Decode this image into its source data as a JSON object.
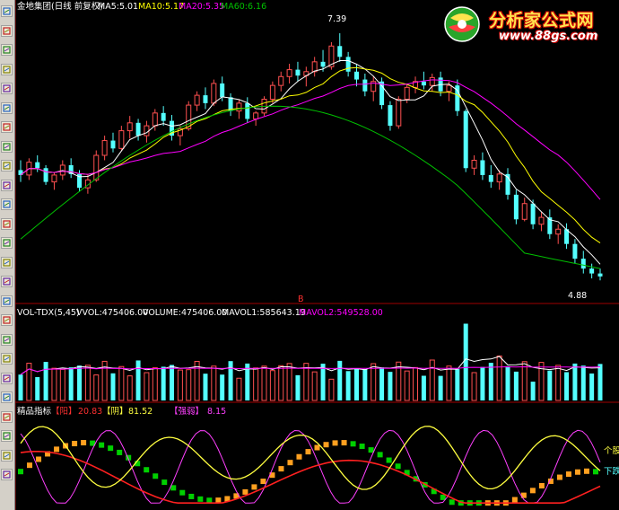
{
  "toolbar": {
    "buttons": [
      {
        "name": "candlestick-icon"
      },
      {
        "name": "line-chart-icon"
      },
      {
        "name": "bar-chart-icon"
      },
      {
        "name": "zoom-icon"
      },
      {
        "name": "grid-icon"
      },
      {
        "name": "indicator-icon"
      },
      {
        "name": "export-icon"
      },
      {
        "name": "settings-icon"
      },
      {
        "name": "window-icon"
      },
      {
        "name": "table-icon"
      },
      {
        "name": "text-icon"
      },
      {
        "name": "calendar-icon"
      },
      {
        "name": "overlay-icon"
      },
      {
        "name": "cursor-icon"
      },
      {
        "name": "split-icon"
      },
      {
        "name": "formula-icon"
      },
      {
        "name": "layout-icon"
      },
      {
        "name": "screen-icon"
      },
      {
        "name": "filter-icon"
      },
      {
        "name": "delete-icon"
      },
      {
        "name": "refresh-icon"
      },
      {
        "name": "arrow-down-icon"
      },
      {
        "name": "arrow-up-icon"
      },
      {
        "name": "arrow-right-icon"
      },
      {
        "name": "arrow-left-icon"
      }
    ]
  },
  "logo": {
    "main": "分析家公式网",
    "url": "www.88gs.com"
  },
  "price_panel": {
    "stock": "金地集团(日线 前复权)",
    "ma5": "MA5:5.01",
    "ma10": "MA10:5.17",
    "ma20": "MA20:5.35",
    "ma60": "MA60:6.16",
    "high_label": "7.39",
    "low_label": "4.88",
    "marker": "B"
  },
  "volume_panel": {
    "title": "VOL-TDX(5,45)",
    "vvol": "VVOL:475406.00",
    "volume": "VOLUME:475406.00",
    "mavol1": "MAVOL1:585643.19",
    "mavol2": "MAVOL2:549528.00"
  },
  "indicator_panel": {
    "title": "精品指标",
    "yang_label": "【阳】",
    "yang_value": "20.83",
    "yin_label": "【阴】",
    "yin_value": "81.52",
    "strong_label": "【强弱】",
    "strong_value": "8.15",
    "right_label_1": "个股",
    "right_label_2": "下跌"
  },
  "colors": {
    "background": "#000000",
    "up": "#ff5050",
    "down": "#54ffff",
    "ma5": "#ffffff",
    "ma10": "#ffff00",
    "ma20": "#ff00ff",
    "ma60": "#00c000",
    "grid": "#a00000",
    "yellow_line": "#ffff40",
    "red_line": "#ff2020",
    "magenta_line": "#ff40ff",
    "green_band": "#00d000",
    "orange_band": "#ffa020"
  },
  "chart_data": {
    "type": "line",
    "price_range": [
      4.7,
      7.6
    ],
    "candles": [
      [
        6.0,
        6.1,
        5.88,
        5.95
      ],
      [
        5.95,
        6.12,
        5.9,
        6.08
      ],
      [
        6.08,
        6.15,
        5.98,
        6.02
      ],
      [
        6.02,
        6.05,
        5.85,
        5.88
      ],
      [
        5.88,
        5.98,
        5.8,
        5.95
      ],
      [
        5.95,
        6.1,
        5.9,
        6.05
      ],
      [
        6.05,
        6.12,
        5.92,
        5.96
      ],
      [
        5.96,
        6.0,
        5.78,
        5.82
      ],
      [
        5.82,
        5.95,
        5.76,
        5.9
      ],
      [
        5.9,
        6.2,
        5.88,
        6.15
      ],
      [
        6.15,
        6.35,
        6.1,
        6.3
      ],
      [
        6.3,
        6.38,
        6.18,
        6.22
      ],
      [
        6.22,
        6.45,
        6.2,
        6.4
      ],
      [
        6.4,
        6.55,
        6.32,
        6.48
      ],
      [
        6.48,
        6.52,
        6.3,
        6.35
      ],
      [
        6.35,
        6.5,
        6.28,
        6.45
      ],
      [
        6.45,
        6.62,
        6.4,
        6.58
      ],
      [
        6.58,
        6.65,
        6.45,
        6.5
      ],
      [
        6.5,
        6.56,
        6.3,
        6.35
      ],
      [
        6.35,
        6.45,
        6.25,
        6.42
      ],
      [
        6.42,
        6.7,
        6.4,
        6.66
      ],
      [
        6.66,
        6.8,
        6.6,
        6.76
      ],
      [
        6.76,
        6.84,
        6.62,
        6.68
      ],
      [
        6.68,
        6.92,
        6.65,
        6.88
      ],
      [
        6.88,
        6.95,
        6.7,
        6.74
      ],
      [
        6.74,
        6.78,
        6.55,
        6.6
      ],
      [
        6.6,
        6.72,
        6.52,
        6.68
      ],
      [
        6.68,
        6.74,
        6.48,
        6.52
      ],
      [
        6.52,
        6.6,
        6.45,
        6.58
      ],
      [
        6.58,
        6.75,
        6.55,
        6.72
      ],
      [
        6.72,
        6.9,
        6.68,
        6.86
      ],
      [
        6.86,
        7.0,
        6.8,
        6.95
      ],
      [
        6.95,
        7.08,
        6.88,
        7.02
      ],
      [
        7.02,
        7.1,
        6.9,
        6.96
      ],
      [
        6.96,
        7.05,
        6.85,
        7.0
      ],
      [
        7.0,
        7.15,
        6.95,
        7.1
      ],
      [
        7.1,
        7.22,
        7.0,
        7.05
      ],
      [
        7.05,
        7.3,
        7.02,
        7.26
      ],
      [
        7.26,
        7.39,
        7.1,
        7.15
      ],
      [
        7.15,
        7.2,
        6.95,
        7.0
      ],
      [
        7.0,
        7.08,
        6.85,
        6.92
      ],
      [
        6.92,
        6.98,
        6.75,
        6.8
      ],
      [
        6.8,
        6.95,
        6.7,
        6.9
      ],
      [
        6.9,
        6.94,
        6.62,
        6.66
      ],
      [
        6.66,
        6.7,
        6.4,
        6.45
      ],
      [
        6.45,
        6.75,
        6.42,
        6.72
      ],
      [
        6.72,
        6.88,
        6.68,
        6.84
      ],
      [
        6.84,
        6.95,
        6.78,
        6.9
      ],
      [
        6.9,
        7.0,
        6.82,
        6.86
      ],
      [
        6.86,
        6.98,
        6.8,
        6.94
      ],
      [
        6.94,
        7.0,
        6.75,
        6.8
      ],
      [
        6.8,
        6.9,
        6.7,
        6.86
      ],
      [
        6.86,
        6.92,
        6.55,
        6.6
      ],
      [
        6.6,
        6.62,
        5.98,
        6.02
      ],
      [
        6.02,
        6.15,
        5.95,
        6.1
      ],
      [
        6.1,
        6.18,
        5.9,
        5.95
      ],
      [
        5.95,
        6.05,
        5.82,
        5.88
      ],
      [
        5.88,
        6.0,
        5.8,
        5.96
      ],
      [
        5.96,
        6.02,
        5.7,
        5.75
      ],
      [
        5.75,
        5.8,
        5.45,
        5.5
      ],
      [
        5.5,
        5.72,
        5.48,
        5.66
      ],
      [
        5.66,
        5.7,
        5.4,
        5.45
      ],
      [
        5.45,
        5.58,
        5.38,
        5.52
      ],
      [
        5.52,
        5.6,
        5.3,
        5.35
      ],
      [
        5.35,
        5.45,
        5.25,
        5.4
      ],
      [
        5.4,
        5.46,
        5.2,
        5.25
      ],
      [
        5.25,
        5.3,
        5.05,
        5.1
      ],
      [
        5.1,
        5.18,
        4.95,
        5.0
      ],
      [
        5.0,
        5.05,
        4.9,
        4.95
      ],
      [
        4.95,
        5.0,
        4.88,
        4.92
      ]
    ]
  }
}
